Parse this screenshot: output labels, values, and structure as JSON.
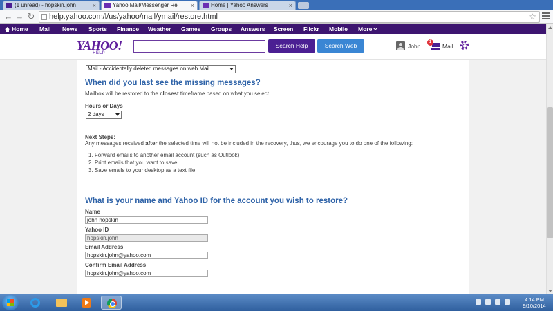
{
  "browser": {
    "tabs": [
      {
        "label": "(1 unread) - hopskin.john"
      },
      {
        "label": "Yahoo Mail/Messenger Re"
      },
      {
        "label": "Home | Yahoo Answers"
      }
    ],
    "url": "help.yahoo.com/l/us/yahoo/mail/ymail/restore.html",
    "close_glyph": "×",
    "back_glyph": "←",
    "forward_glyph": "→",
    "reload_glyph": "↻",
    "star_glyph": "☆"
  },
  "yahoo_nav": [
    "Home",
    "Mail",
    "News",
    "Sports",
    "Finance",
    "Weather",
    "Games",
    "Groups",
    "Answers",
    "Screen",
    "Flickr",
    "Mobile",
    "More"
  ],
  "header": {
    "logo": "YAHOO!",
    "logo_sub": "HELP",
    "search_help_label": "Search Help",
    "search_web_label": "Search Web",
    "user_name": "John",
    "mail_label": "Mail",
    "mail_badge": "1"
  },
  "form": {
    "issue_select": "Mail - Accidentally deleted messages on web Mail",
    "when_heading": "When did you last see the missing messages?",
    "restore_pre": "Mailbox will be restored to the",
    "restore_bold": "closest",
    "restore_post": "timeframe based on what you select",
    "hours_label": "Hours or Days",
    "hours_select": "2 days",
    "next_steps_label": "Next Steps:",
    "next_pre": "Any messages received",
    "next_bold": "after",
    "next_post": "the selected time will not be included in the recovery, thus, we encourage you to do one of the following:",
    "steps": [
      "1.  Forward emails to another email account (such as Outlook)",
      "2.  Print emails that you want to save.",
      "3.  Save emails to your desktop as a text file."
    ],
    "identity_heading": "What is your name and Yahoo ID for the account you wish to restore?",
    "name_label": "Name",
    "name_value": "john hopskin",
    "yahoo_id_label": "Yahoo ID",
    "yahoo_id_value": "hopskin.john",
    "email_label": "Email Address",
    "email_value": "hopskin.john@yahoo.com",
    "confirm_label": "Confirm Email Address",
    "confirm_value": "hopskin.john@yahoo.com"
  },
  "taskbar": {
    "time": "4:14 PM",
    "date": "9/10/2014"
  },
  "colors": {
    "yahoo_purple": "#3d1570",
    "heading_blue": "#2f63a8",
    "search_web_blue": "#3a86d4"
  }
}
